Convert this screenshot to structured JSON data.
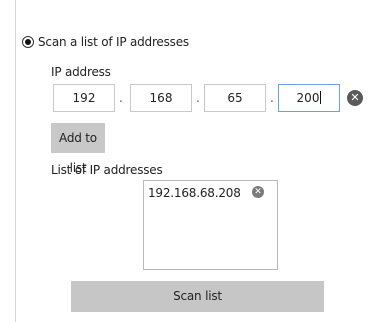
{
  "scan_option": {
    "label": "Scan a list of IP addresses",
    "selected": true
  },
  "ip_entry": {
    "label": "IP address",
    "octets": [
      "192",
      "168",
      "65",
      "200"
    ],
    "separator": ".",
    "clear_icon": "x-circle-icon"
  },
  "add_button": {
    "label": "Add to list"
  },
  "ip_list": {
    "label": "List of IP addresses",
    "items": [
      {
        "address": "192.168.68.208",
        "remove_icon": "x-circle-icon"
      }
    ]
  },
  "scan_button": {
    "label": "Scan list"
  }
}
